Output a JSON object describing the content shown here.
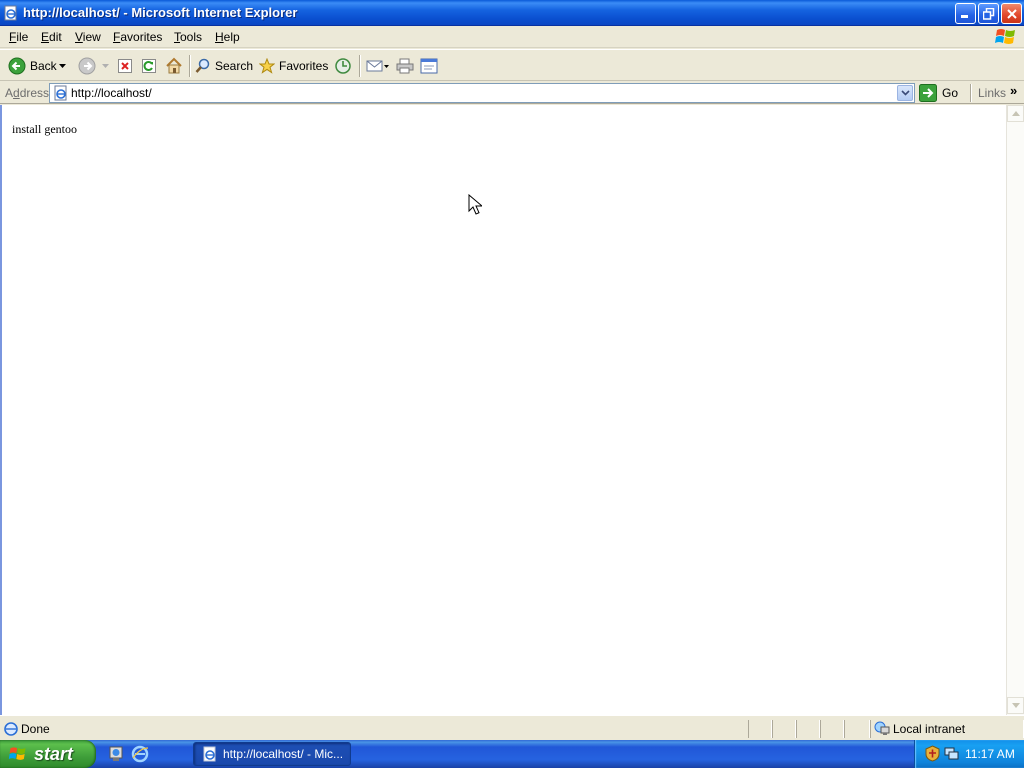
{
  "window": {
    "title": "http://localhost/ - Microsoft Internet Explorer"
  },
  "menu": [
    {
      "label": "File",
      "u": "F",
      "rest": "ile"
    },
    {
      "label": "Edit",
      "u": "E",
      "rest": "dit"
    },
    {
      "label": "View",
      "u": "V",
      "rest": "iew"
    },
    {
      "label": "Favorites",
      "u": "F",
      "rest": "avorites",
      "pre": ""
    },
    {
      "label": "Tools",
      "u": "T",
      "rest": "ools"
    },
    {
      "label": "Help",
      "u": "H",
      "rest": "elp"
    }
  ],
  "toolbar": {
    "back_label": "Back",
    "search_label": "Search",
    "favorites_label": "Favorites"
  },
  "address": {
    "label_prefix": "A",
    "label_u": "d",
    "label_rest": "dress",
    "value": "http://localhost/",
    "go_label": "Go",
    "links_label": "Links",
    "links_chevron": "»"
  },
  "page": {
    "body_text": "install gentoo"
  },
  "status": {
    "text": "Done",
    "zone": "Local intranet"
  },
  "taskbar": {
    "start_label": "start",
    "task_label": "http://localhost/ - Mic...",
    "clock": "11:17 AM"
  },
  "colors": {
    "titlebar": "#0a4fd0",
    "window_face": "#ece9d8",
    "taskbar": "#2663e0",
    "start_green": "#3f9e3a",
    "tray": "#0f83db"
  }
}
